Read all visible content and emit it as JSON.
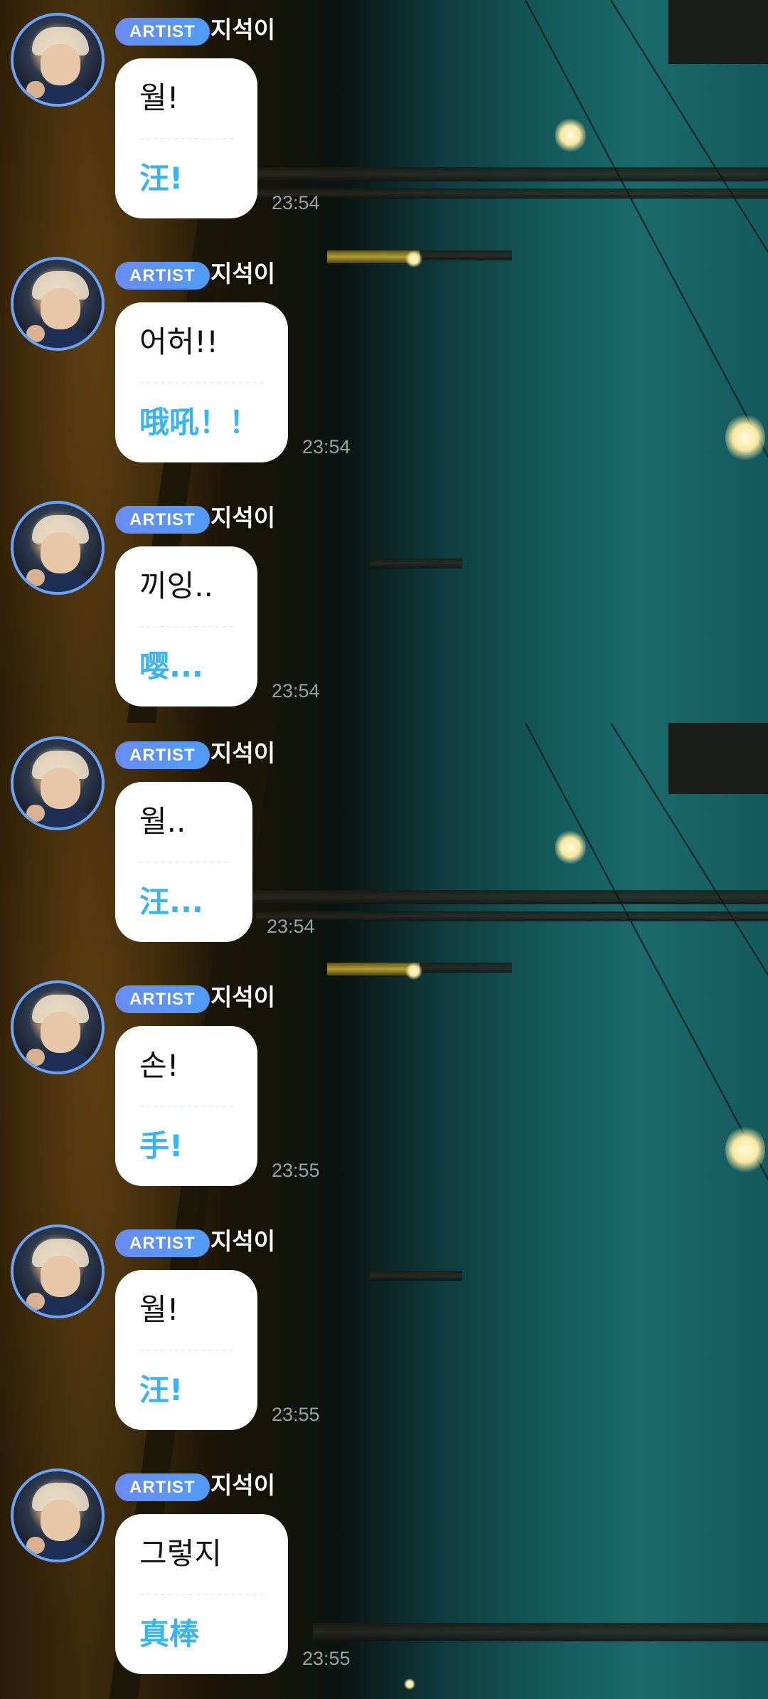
{
  "badge_label": "ARTIST",
  "sender_name": "지석이",
  "messages": [
    {
      "ko": "월!",
      "zh": "汪!",
      "time": "23:54"
    },
    {
      "ko": "어허!!",
      "zh": "哦吼！！",
      "time": "23:54"
    },
    {
      "ko": "끼잉..",
      "zh": "嘤...",
      "time": "23:54"
    },
    {
      "ko": "월..",
      "zh": "汪...",
      "time": "23:54"
    },
    {
      "ko": "손!",
      "zh": "手!",
      "time": "23:55"
    },
    {
      "ko": "월!",
      "zh": "汪!",
      "time": "23:55"
    },
    {
      "ko": "그렇지",
      "zh": "真棒",
      "time": "23:55"
    }
  ]
}
